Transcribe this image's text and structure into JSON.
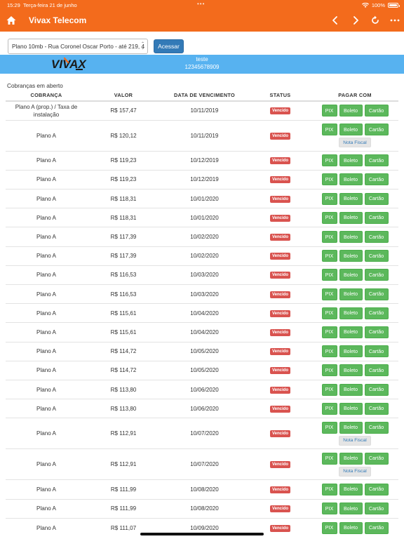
{
  "statusbar": {
    "time": "15:29",
    "date": "Terça-feira 21 de junho",
    "battery": "100%"
  },
  "navbar": {
    "title": "Vivax Telecom"
  },
  "toolbar": {
    "plan_select": "Plano 10mb - Rua Coronel Oscar Porto - até 219, 4",
    "access_label": "Acessar"
  },
  "banner": {
    "logo_text": "VIVAX",
    "line1": "teste",
    "line2": "12345678909"
  },
  "section_label": "Cobranças em aberto",
  "table": {
    "headers": [
      "COBRANÇA",
      "VALOR",
      "DATA DE VENCIMENTO",
      "STATUS",
      "PAGAR COM"
    ],
    "pay_labels": {
      "pix": "PIX",
      "boleto": "Boleto",
      "cartao": "Cartão",
      "nota_fiscal": "Nota Fiscal"
    },
    "rows": [
      {
        "cobranca": "Plano A (prop.) / Taxa de instalação",
        "valor": "R$ 157,47",
        "data": "10/11/2019",
        "status": "Vencido",
        "nota": false
      },
      {
        "cobranca": "Plano A",
        "valor": "R$ 120,12",
        "data": "10/11/2019",
        "status": "Vencido",
        "nota": true
      },
      {
        "cobranca": "Plano A",
        "valor": "R$ 119,23",
        "data": "10/12/2019",
        "status": "Vencido",
        "nota": false
      },
      {
        "cobranca": "Plano A",
        "valor": "R$ 119,23",
        "data": "10/12/2019",
        "status": "Vencido",
        "nota": false
      },
      {
        "cobranca": "Plano A",
        "valor": "R$ 118,31",
        "data": "10/01/2020",
        "status": "Vencido",
        "nota": false
      },
      {
        "cobranca": "Plano A",
        "valor": "R$ 118,31",
        "data": "10/01/2020",
        "status": "Vencido",
        "nota": false
      },
      {
        "cobranca": "Plano A",
        "valor": "R$ 117,39",
        "data": "10/02/2020",
        "status": "Vencido",
        "nota": false
      },
      {
        "cobranca": "Plano A",
        "valor": "R$ 117,39",
        "data": "10/02/2020",
        "status": "Vencido",
        "nota": false
      },
      {
        "cobranca": "Plano A",
        "valor": "R$ 116,53",
        "data": "10/03/2020",
        "status": "Vencido",
        "nota": false
      },
      {
        "cobranca": "Plano A",
        "valor": "R$ 116,53",
        "data": "10/03/2020",
        "status": "Vencido",
        "nota": false
      },
      {
        "cobranca": "Plano A",
        "valor": "R$ 115,61",
        "data": "10/04/2020",
        "status": "Vencido",
        "nota": false
      },
      {
        "cobranca": "Plano A",
        "valor": "R$ 115,61",
        "data": "10/04/2020",
        "status": "Vencido",
        "nota": false
      },
      {
        "cobranca": "Plano A",
        "valor": "R$ 114,72",
        "data": "10/05/2020",
        "status": "Vencido",
        "nota": false
      },
      {
        "cobranca": "Plano A",
        "valor": "R$ 114,72",
        "data": "10/05/2020",
        "status": "Vencido",
        "nota": false
      },
      {
        "cobranca": "Plano A",
        "valor": "R$ 113,80",
        "data": "10/06/2020",
        "status": "Vencido",
        "nota": false
      },
      {
        "cobranca": "Plano A",
        "valor": "R$ 113,80",
        "data": "10/06/2020",
        "status": "Vencido",
        "nota": false
      },
      {
        "cobranca": "Plano A",
        "valor": "R$ 112,91",
        "data": "10/07/2020",
        "status": "Vencido",
        "nota": true
      },
      {
        "cobranca": "Plano A",
        "valor": "R$ 112,91",
        "data": "10/07/2020",
        "status": "Vencido",
        "nota": true
      },
      {
        "cobranca": "Plano A",
        "valor": "R$ 111,99",
        "data": "10/08/2020",
        "status": "Vencido",
        "nota": false
      },
      {
        "cobranca": "Plano A",
        "valor": "R$ 111,99",
        "data": "10/08/2020",
        "status": "Vencido",
        "nota": false
      },
      {
        "cobranca": "Plano A",
        "valor": "R$ 111,07",
        "data": "10/09/2020",
        "status": "Vencido",
        "nota": false
      }
    ]
  },
  "colors": {
    "brand_orange": "#f36b1c",
    "banner_blue": "#57b2f0",
    "primary": "#337ab7",
    "success": "#5cb85c",
    "danger": "#d9534f"
  },
  "icons": {
    "home": "home-icon",
    "back": "chevron-left-icon",
    "forward": "chevron-right-icon",
    "reload": "reload-icon",
    "more": "more-icon"
  }
}
